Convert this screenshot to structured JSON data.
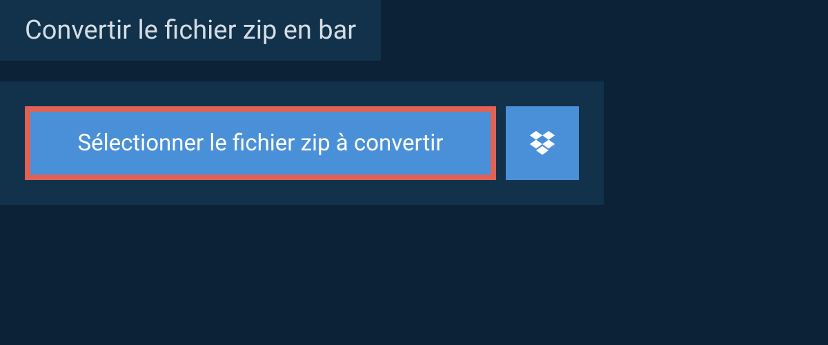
{
  "header": {
    "title": "Convertir le fichier zip en bar"
  },
  "main": {
    "select_button_label": "Sélectionner le fichier zip à convertir"
  }
}
